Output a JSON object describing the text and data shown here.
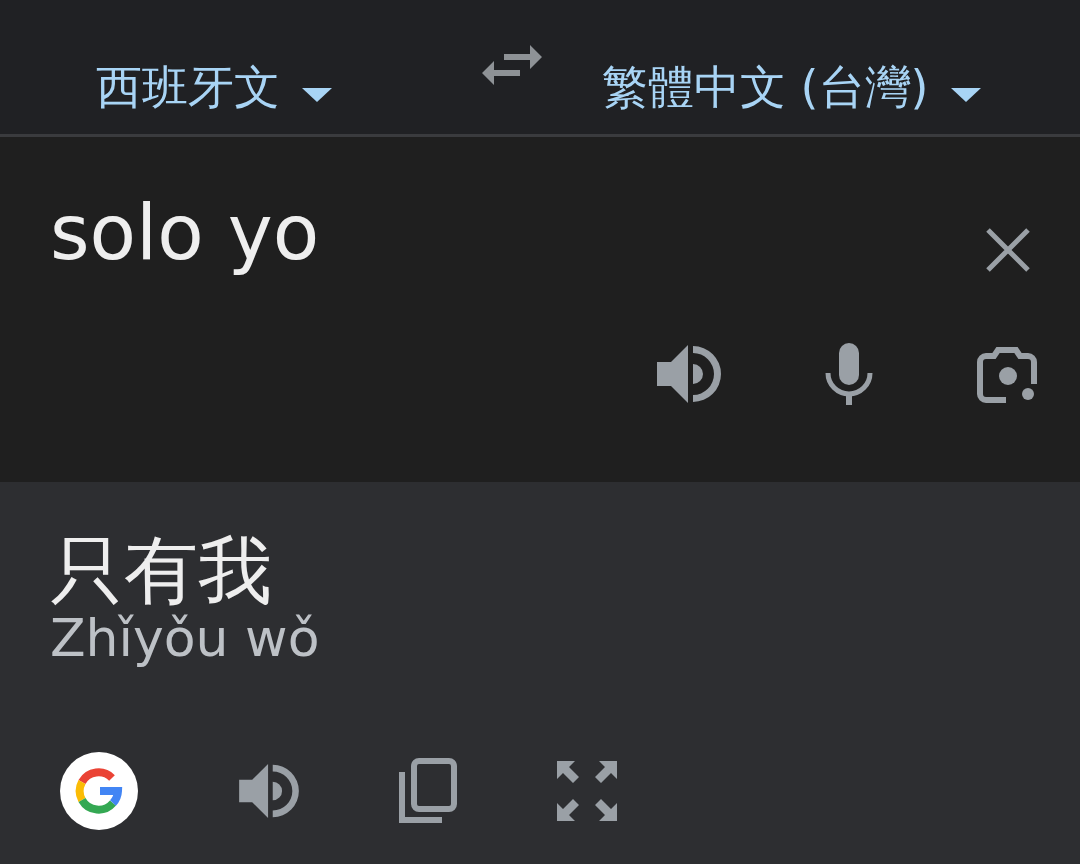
{
  "language_bar": {
    "source_language": "西班牙文",
    "target_language": "繁體中文 (台灣)"
  },
  "input": {
    "value": "solo yo"
  },
  "output": {
    "translation": "只有我",
    "romanization": "Zhǐyǒu wǒ"
  }
}
